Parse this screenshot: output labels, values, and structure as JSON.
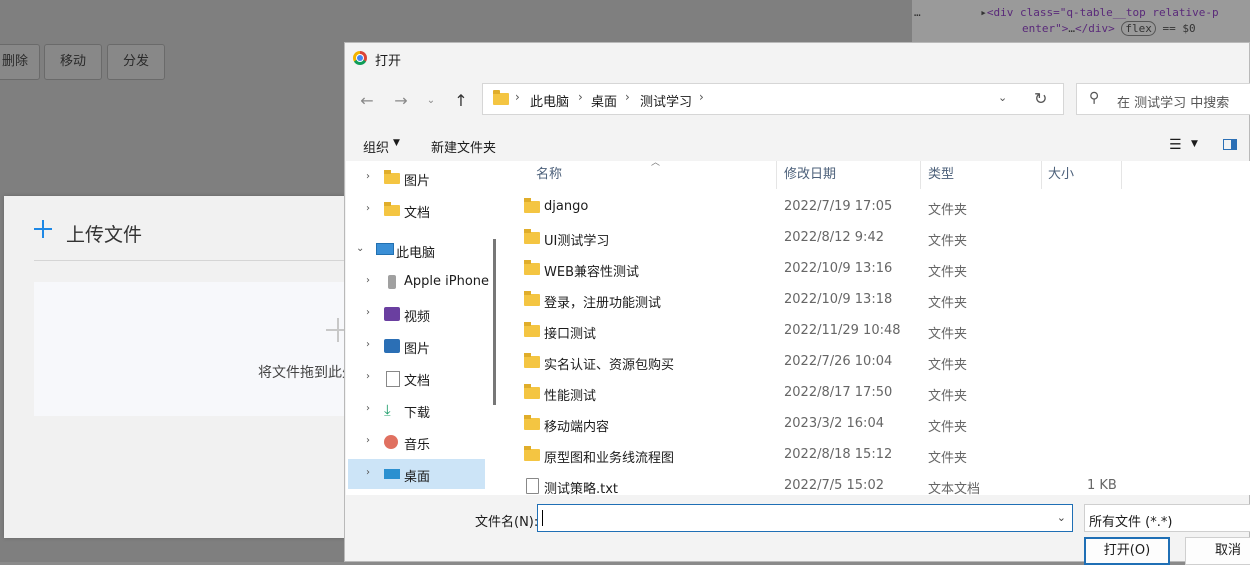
{
  "background": {
    "buttons": [
      "删除",
      "移动",
      "分发"
    ],
    "devtools": {
      "line1_tag": "<div class=\"q-table__top relative-p",
      "line2": "enter\">",
      "line2_ellipsis": "…",
      "line2_close": "</div>",
      "pill": "flex",
      "line2_tail": "== $0",
      "dots": "…"
    },
    "upload": {
      "title": "上传文件",
      "drop_text": "将文件拖到此处"
    }
  },
  "dialog": {
    "title": "打开",
    "breadcrumb": [
      "此电脑",
      "桌面",
      "测试学习"
    ],
    "search_placeholder": "在 测试学习 中搜索",
    "toolbar": {
      "organize": "组织",
      "new_folder": "新建文件夹"
    },
    "tree": [
      {
        "label": "图片",
        "icon": "folder-icon",
        "arrow": "›"
      },
      {
        "label": "文档",
        "icon": "folder-icon",
        "arrow": "›"
      },
      {
        "label": "此电脑",
        "icon": "computer-icon",
        "arrow": "⌄"
      },
      {
        "label": "Apple iPhone",
        "icon": "phone-icon",
        "arrow": "›"
      },
      {
        "label": "视频",
        "icon": "video-icon",
        "arrow": "›"
      },
      {
        "label": "图片",
        "icon": "picture-icon",
        "arrow": "›"
      },
      {
        "label": "文档",
        "icon": "document-icon",
        "arrow": "›"
      },
      {
        "label": "下载",
        "icon": "download-icon",
        "arrow": "›"
      },
      {
        "label": "音乐",
        "icon": "music-icon",
        "arrow": "›"
      },
      {
        "label": "桌面",
        "icon": "desktop-icon",
        "arrow": "›",
        "selected": true
      }
    ],
    "columns": {
      "name": "名称",
      "date": "修改日期",
      "type": "类型",
      "size": "大小"
    },
    "files": [
      {
        "name": "django",
        "date": "2022/7/19 17:05",
        "type": "文件夹",
        "size": ""
      },
      {
        "name": "UI测试学习",
        "date": "2022/8/12 9:42",
        "type": "文件夹",
        "size": ""
      },
      {
        "name": "WEB兼容性测试",
        "date": "2022/10/9 13:16",
        "type": "文件夹",
        "size": ""
      },
      {
        "name": "登录，注册功能测试",
        "date": "2022/10/9 13:18",
        "type": "文件夹",
        "size": ""
      },
      {
        "name": "接口测试",
        "date": "2022/11/29 10:48",
        "type": "文件夹",
        "size": ""
      },
      {
        "name": "实名认证、资源包购买",
        "date": "2022/7/26 10:04",
        "type": "文件夹",
        "size": ""
      },
      {
        "name": "性能测试",
        "date": "2022/8/17 17:50",
        "type": "文件夹",
        "size": ""
      },
      {
        "name": "移动端内容",
        "date": "2023/3/2 16:04",
        "type": "文件夹",
        "size": ""
      },
      {
        "name": "原型图和业务线流程图",
        "date": "2022/8/18 15:12",
        "type": "文件夹",
        "size": ""
      },
      {
        "name": "测试策略.txt",
        "date": "2022/7/5 15:02",
        "type": "文本文档",
        "size": "1 KB"
      }
    ],
    "filename_label": "文件名(N):",
    "filename_value": "",
    "filter": "所有文件 (*.*)",
    "open_button": "打开(O)",
    "cancel_button": "取消"
  }
}
